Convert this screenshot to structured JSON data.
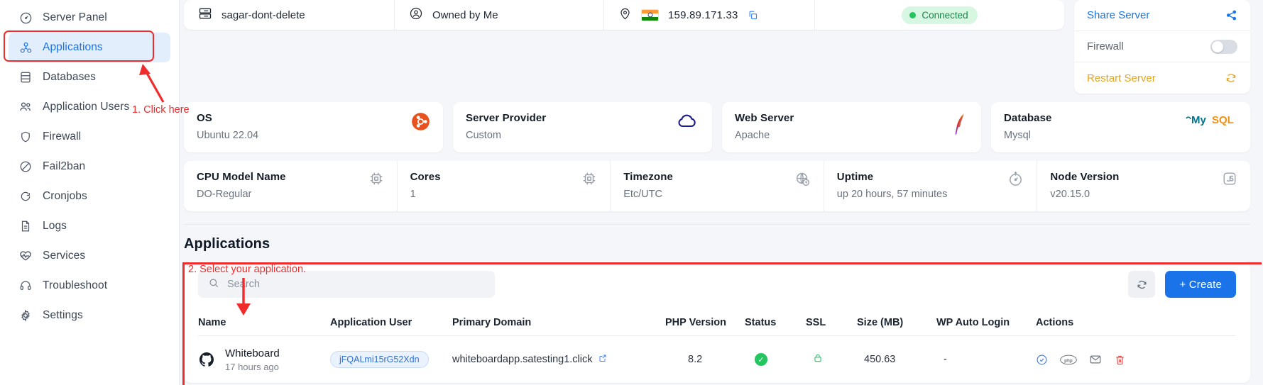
{
  "sidebar": {
    "items": [
      {
        "label": "Server Panel",
        "icon": "gauge-icon",
        "active": false
      },
      {
        "label": "Applications",
        "icon": "apps-icon",
        "active": true
      },
      {
        "label": "Databases",
        "icon": "database-icon",
        "active": false
      },
      {
        "label": "Application Users",
        "icon": "users-icon",
        "active": false
      },
      {
        "label": "Firewall",
        "icon": "shield-icon",
        "active": false
      },
      {
        "label": "Fail2ban",
        "icon": "ban-icon",
        "active": false
      },
      {
        "label": "Cronjobs",
        "icon": "refresh-icon",
        "active": false
      },
      {
        "label": "Logs",
        "icon": "document-icon",
        "active": false
      },
      {
        "label": "Services",
        "icon": "heartbeat-icon",
        "active": false
      },
      {
        "label": "Troubleshoot",
        "icon": "headset-icon",
        "active": false
      },
      {
        "label": "Settings",
        "icon": "gear-icon",
        "active": false
      }
    ]
  },
  "summary": {
    "server_name": "sagar-dont-delete",
    "ownership": "Owned by Me",
    "ip_address": "159.89.171.33",
    "status": "Connected",
    "status_color": "#17864a"
  },
  "actions": {
    "share_label": "Share Server",
    "firewall_label": "Firewall",
    "firewall_state": "off",
    "restart_label": "Restart Server",
    "share_color": "#1a73e8",
    "restart_color": "#e9a319"
  },
  "info_cards": [
    {
      "title": "OS",
      "value": "Ubuntu 22.04",
      "icon": "ubuntu-icon"
    },
    {
      "title": "Server Provider",
      "value": "Custom",
      "icon": "cloud-icon"
    },
    {
      "title": "Web Server",
      "value": "Apache",
      "icon": "apache-feather-icon"
    },
    {
      "title": "Database",
      "value": "Mysql",
      "icon": "mysql-icon"
    }
  ],
  "stats": [
    {
      "title": "CPU Model Name",
      "value": "DO-Regular",
      "icon": "cpu-icon"
    },
    {
      "title": "Cores",
      "value": "1",
      "icon": "cpu-icon"
    },
    {
      "title": "Timezone",
      "value": "Etc/UTC",
      "icon": "globe-clock-icon"
    },
    {
      "title": "Uptime",
      "value": "up 20 hours, 57 minutes",
      "icon": "speedometer-icon"
    },
    {
      "title": "Node Version",
      "value": "v20.15.0",
      "icon": "js-icon"
    }
  ],
  "applications": {
    "heading": "Applications",
    "search_placeholder": "Search",
    "search_value": "",
    "refresh_label": "refresh",
    "create_label": "+ Create",
    "columns": [
      "Name",
      "Application User",
      "Primary Domain",
      "PHP Version",
      "Status",
      "SSL",
      "Size (MB)",
      "WP Auto Login",
      "Actions"
    ],
    "rows": [
      {
        "name": "Whiteboard",
        "created": "17 hours ago",
        "app_user": "jFQALmi15rG52Xdn",
        "primary_domain": "whiteboardapp.satesting1.click",
        "php_version": "8.2",
        "status": "active",
        "ssl": "locked",
        "size_mb": "450.63",
        "wp_auto_login": "-",
        "actions": [
          "open-app-icon",
          "php-icon",
          "mail-icon",
          "delete-icon"
        ]
      }
    ]
  },
  "annotations": [
    {
      "text": "1. Click here"
    },
    {
      "text": "2. Select your application."
    }
  ]
}
